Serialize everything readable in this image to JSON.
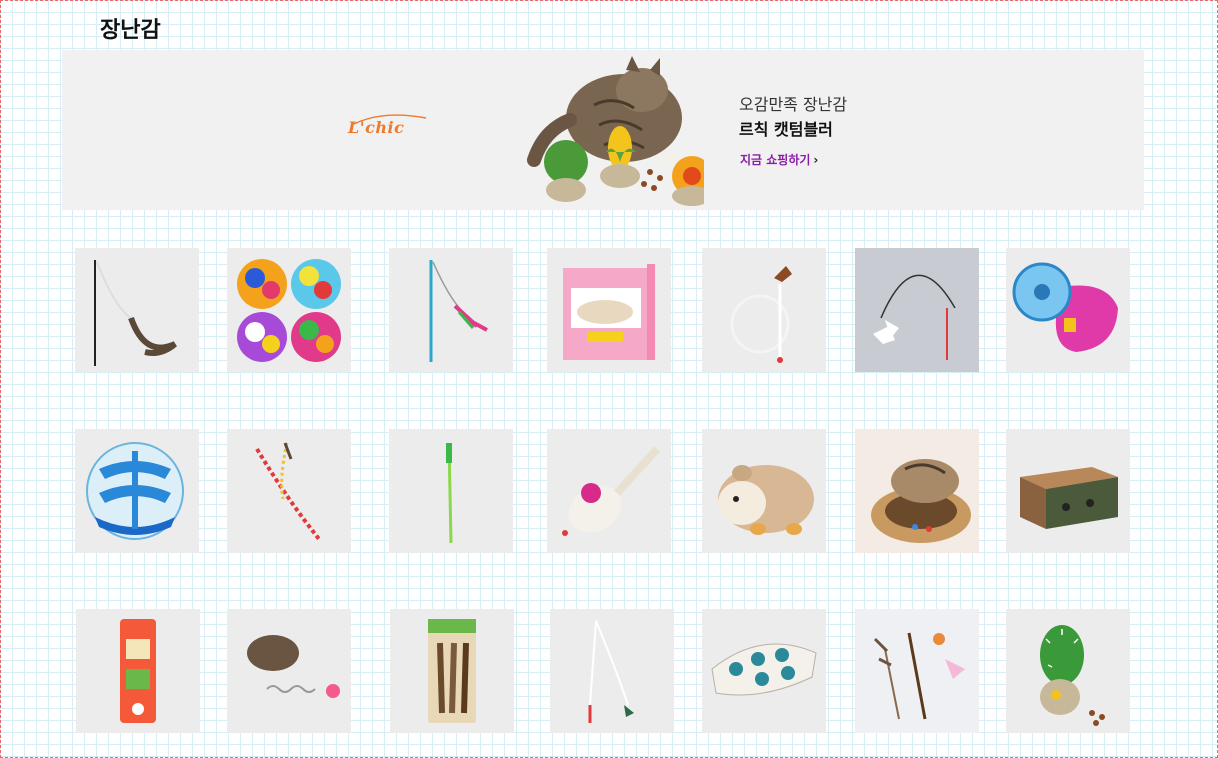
{
  "section": {
    "title": "장난감"
  },
  "banner": {
    "brand": "L'chic",
    "subtitle": "오감만족 장난감",
    "headline": "르칙 캣텀블러",
    "cta": "지금 쇼핑하기",
    "accent": "#8a1ea8",
    "brand_color": "#ee7a2c"
  },
  "products": [
    {
      "icon": "wand-feather-toy-icon"
    },
    {
      "icon": "pompom-balls-icon"
    },
    {
      "icon": "feather-wand-icon"
    },
    {
      "icon": "boxed-play-mat-icon"
    },
    {
      "icon": "ring-feather-toy-icon"
    },
    {
      "icon": "wire-butterfly-toy-icon"
    },
    {
      "icon": "wheel-toy-icon"
    },
    {
      "icon": "treat-ball-icon"
    },
    {
      "icon": "bead-string-toy-icon"
    },
    {
      "icon": "green-stick-toy-icon"
    },
    {
      "icon": "plush-mouse-icon"
    },
    {
      "icon": "plush-hamster-icon"
    },
    {
      "icon": "cat-scratcher-bowl-icon"
    },
    {
      "icon": "cardboard-box-icon"
    },
    {
      "icon": "catnip-pillow-icon"
    },
    {
      "icon": "spring-feather-toy-icon"
    },
    {
      "icon": "matatabi-sticks-icon"
    },
    {
      "icon": "fishing-rod-toy-icon"
    },
    {
      "icon": "puzzle-feeder-icon"
    },
    {
      "icon": "feather-set-icon"
    },
    {
      "icon": "cactus-tumbler-icon"
    }
  ]
}
